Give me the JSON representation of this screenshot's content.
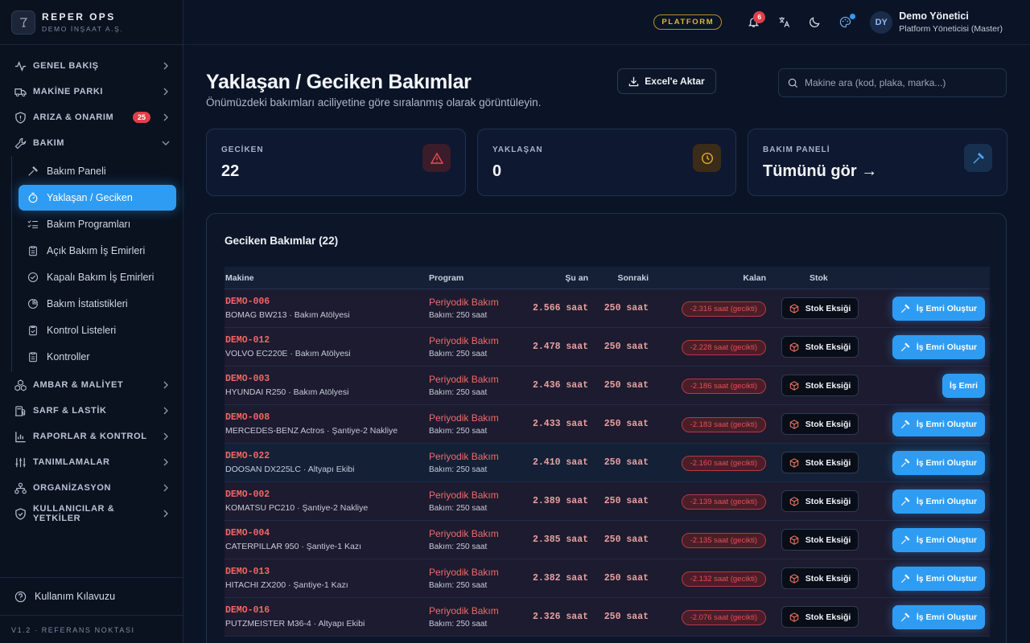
{
  "brand": {
    "name": "REPER OPS",
    "subtitle": "DEMO İNŞAAT A.Ş."
  },
  "nav": {
    "genel": "GENEL BAKIŞ",
    "makine": "MAKİNE PARKI",
    "ariza": "ARIZA & ONARIM",
    "ariza_badge": "25",
    "bakim": "BAKIM",
    "bakim_sub": {
      "panel": "Bakım Paneli",
      "yaklasan": "Yaklaşan / Geciken",
      "programlar": "Bakım Programları",
      "acik": "Açık Bakım İş Emirleri",
      "kapali": "Kapalı Bakım İş Emirleri",
      "istatistik": "Bakım İstatistikleri",
      "kontrol_listeleri": "Kontrol Listeleri",
      "kontroller": "Kontroller"
    },
    "ambar": "AMBAR & MALİYET",
    "sarf": "SARF & LASTİK",
    "raporlar": "RAPORLAR & KONTROL",
    "tanimlamalar": "TANIMLAMALAR",
    "organizasyon": "ORGANİZASYON",
    "kullanicilar": "KULLANICILAR & YETKİLER"
  },
  "sidebar_footer": {
    "guide": "Kullanım Kılavuzu",
    "version": "V1.2 · REFERANS NOKTASI"
  },
  "topbar": {
    "platform": "PLATFORM",
    "notifications": "6",
    "avatar": "DY",
    "user_name": "Demo Yönetici",
    "user_role": "Platform Yöneticisi (Master)"
  },
  "page": {
    "title": "Yaklaşan / Geciken Bakımlar",
    "subtitle": "Önümüzdeki bakımları aciliyetine göre sıralanmış olarak görüntüleyin.",
    "export": "Excel'e Aktar",
    "search_placeholder": "Makine ara (kod, plaka, marka...)"
  },
  "cards": {
    "late_label": "GECİKEN",
    "late_value": "22",
    "upcoming_label": "YAKLAŞAN",
    "upcoming_value": "0",
    "panel_label": "BAKIM PANELİ",
    "panel_value": "Tümünü gör →"
  },
  "table": {
    "title": "Geciken Bakımlar (22)",
    "headers": {
      "machine": "Makine",
      "program": "Program",
      "now": "Şu an",
      "next": "Sonraki",
      "remaining": "Kalan",
      "stock": "Stok"
    },
    "rows": [
      {
        "code": "DEMO-006",
        "desc": "BOMAG BW213 · Bakım Atölyesi",
        "program": "Periyodik Bakım",
        "program_sub": "Bakım: 250 saat",
        "now": "2.566 saat",
        "next": "250 saat",
        "remaining": "-2.316 saat (gecikti)",
        "stock": "Stok Eksiği",
        "action": "İş Emri Oluştur"
      },
      {
        "code": "DEMO-012",
        "desc": "VOLVO EC220E · Bakım Atölyesi",
        "program": "Periyodik Bakım",
        "program_sub": "Bakım: 250 saat",
        "now": "2.478 saat",
        "next": "250 saat",
        "remaining": "-2.228 saat (gecikti)",
        "stock": "Stok Eksiği",
        "action": "İş Emri Oluştur"
      },
      {
        "code": "DEMO-003",
        "desc": "HYUNDAI R250 · Bakım Atölyesi",
        "program": "Periyodik Bakım",
        "program_sub": "Bakım: 250 saat",
        "now": "2.436 saat",
        "next": "250 saat",
        "remaining": "-2.186 saat (gecikti)",
        "stock": "Stok Eksiği",
        "action": "İş Emri"
      },
      {
        "code": "DEMO-008",
        "desc": "MERCEDES-BENZ Actros · Şantiye-2 Nakliye",
        "program": "Periyodik Bakım",
        "program_sub": "Bakım: 250 saat",
        "now": "2.433 saat",
        "next": "250 saat",
        "remaining": "-2.183 saat (gecikti)",
        "stock": "Stok Eksiği",
        "action": "İş Emri Oluştur"
      },
      {
        "code": "DEMO-022",
        "desc": "DOOSAN DX225LC · Altyapı Ekibi",
        "program": "Periyodik Bakım",
        "program_sub": "Bakım: 250 saat",
        "now": "2.410 saat",
        "next": "250 saat",
        "remaining": "-2.160 saat (gecikti)",
        "stock": "Stok Eksiği",
        "action": "İş Emri Oluştur"
      },
      {
        "code": "DEMO-002",
        "desc": "KOMATSU PC210 · Şantiye-2 Nakliye",
        "program": "Periyodik Bakım",
        "program_sub": "Bakım: 250 saat",
        "now": "2.389 saat",
        "next": "250 saat",
        "remaining": "-2.139 saat (gecikti)",
        "stock": "Stok Eksiği",
        "action": "İş Emri Oluştur"
      },
      {
        "code": "DEMO-004",
        "desc": "CATERPILLAR 950 · Şantiye-1 Kazı",
        "program": "Periyodik Bakım",
        "program_sub": "Bakım: 250 saat",
        "now": "2.385 saat",
        "next": "250 saat",
        "remaining": "-2.135 saat (gecikti)",
        "stock": "Stok Eksiği",
        "action": "İş Emri Oluştur"
      },
      {
        "code": "DEMO-013",
        "desc": "HITACHI ZX200 · Şantiye-1 Kazı",
        "program": "Periyodik Bakım",
        "program_sub": "Bakım: 250 saat",
        "now": "2.382 saat",
        "next": "250 saat",
        "remaining": "-2.132 saat (gecikti)",
        "stock": "Stok Eksiği",
        "action": "İş Emri Oluştur"
      },
      {
        "code": "DEMO-016",
        "desc": "PUTZMEISTER M36-4 · Altyapı Ekibi",
        "program": "Periyodik Bakım",
        "program_sub": "Bakım: 250 saat",
        "now": "2.326 saat",
        "next": "250 saat",
        "remaining": "-2.076 saat (gecikti)",
        "stock": "Stok Eksiği",
        "action": "İş Emri Oluştur"
      }
    ]
  },
  "colors": {
    "accent": "#2f9cf3",
    "danger": "#e03f49",
    "warning": "#e0b53c",
    "background": "#0b1426"
  }
}
